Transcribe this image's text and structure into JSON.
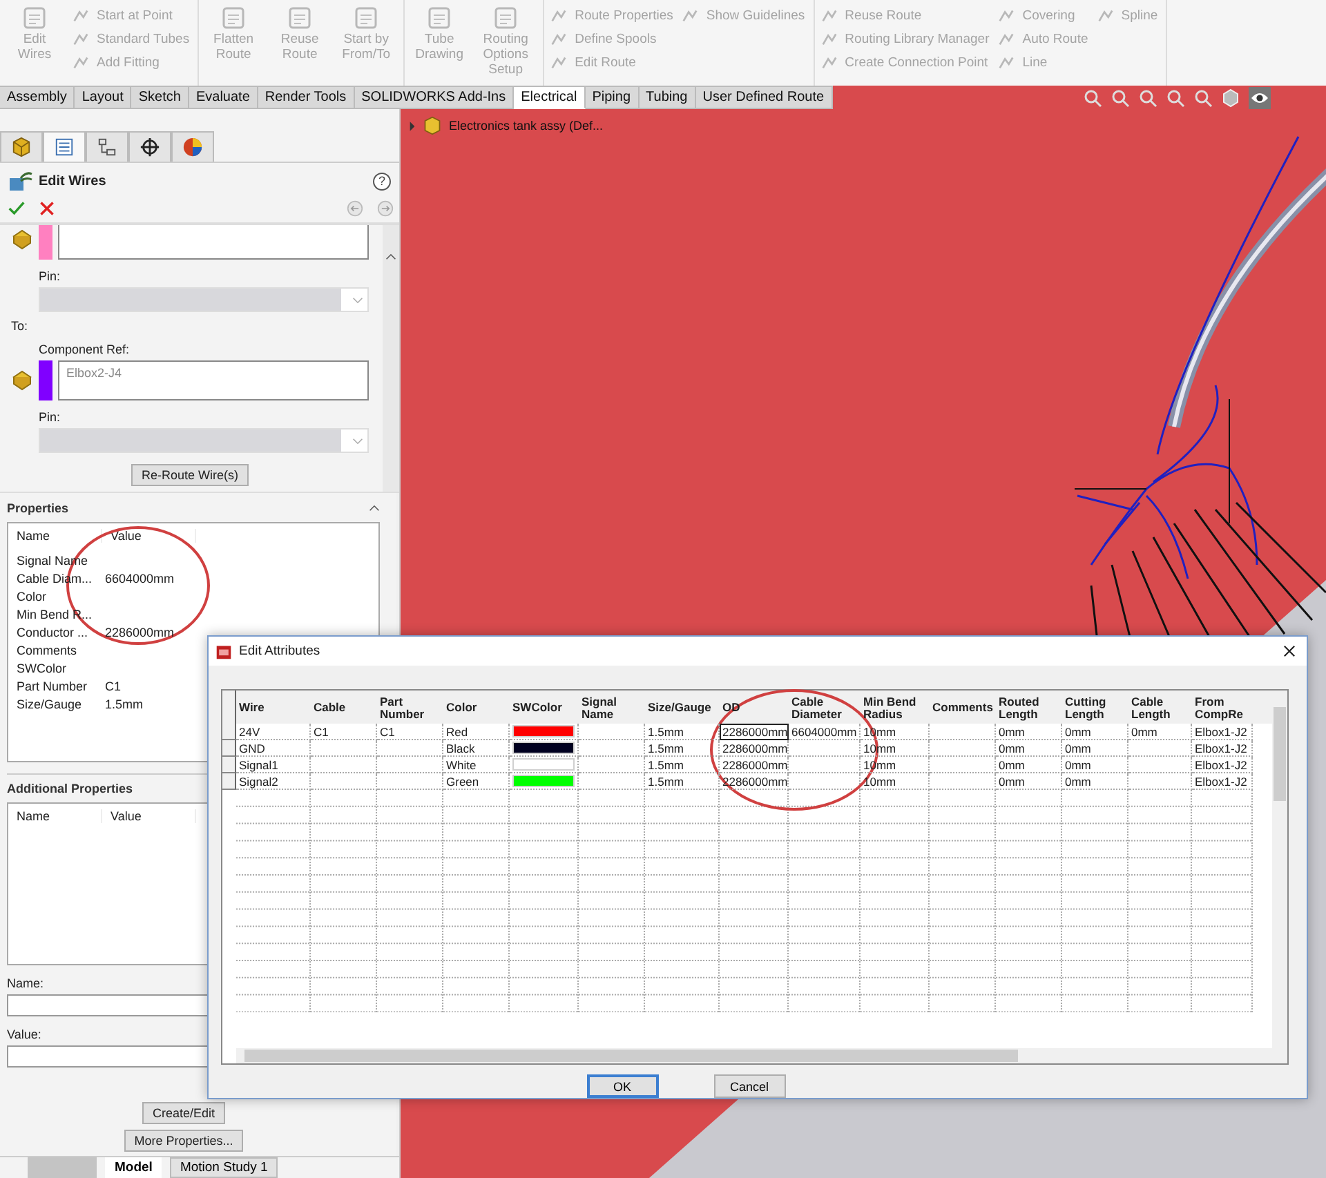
{
  "toolbar": [
    {
      "items": [
        {
          "kind": "large",
          "label": "Edit Wires",
          "disabled": true
        },
        {
          "kind": "stack",
          "items": [
            {
              "label": "Start at Point",
              "disabled": true
            },
            {
              "label": "Standard Tubes",
              "disabled": true
            },
            {
              "label": "Add Fitting",
              "disabled": true
            }
          ]
        }
      ]
    },
    {
      "items": [
        {
          "kind": "large",
          "label": "Flatten Route",
          "disabled": true
        },
        {
          "kind": "large",
          "label": "Reuse Route",
          "disabled": true
        },
        {
          "kind": "large",
          "label": "Start by From/To",
          "disabled": true
        }
      ]
    },
    {
      "items": [
        {
          "kind": "large",
          "label": "Tube Drawing",
          "disabled": true
        },
        {
          "kind": "large",
          "label": "Routing Options Setup",
          "disabled": true
        }
      ]
    },
    {
      "items": [
        {
          "kind": "stack",
          "items": [
            {
              "label": "Route Properties",
              "disabled": true
            },
            {
              "label": "Define Spools",
              "disabled": true
            },
            {
              "label": "Edit Route",
              "disabled": true
            }
          ]
        },
        {
          "kind": "stack",
          "items": [
            {
              "label": "Show Guidelines",
              "disabled": true
            }
          ]
        }
      ]
    },
    {
      "items": [
        {
          "kind": "stack",
          "items": [
            {
              "label": "Reuse Route",
              "disabled": true
            },
            {
              "label": "Routing Library Manager",
              "disabled": true
            },
            {
              "label": "Create Connection Point",
              "disabled": true
            }
          ]
        },
        {
          "kind": "stack",
          "items": [
            {
              "label": "Covering",
              "disabled": true
            },
            {
              "label": "Auto Route",
              "disabled": true
            },
            {
              "label": "Line",
              "disabled": true
            }
          ]
        },
        {
          "kind": "stack",
          "items": [
            {
              "label": "Spline",
              "disabled": true
            }
          ]
        }
      ]
    }
  ],
  "command_tabs": [
    {
      "label": "Assembly",
      "selected": false
    },
    {
      "label": "Layout",
      "selected": false
    },
    {
      "label": "Sketch",
      "selected": false
    },
    {
      "label": "Evaluate",
      "selected": false
    },
    {
      "label": "Render Tools",
      "selected": false
    },
    {
      "label": "SOLIDWORKS Add-Ins",
      "selected": false
    },
    {
      "label": "Electrical",
      "selected": true
    },
    {
      "label": "Piping",
      "selected": false
    },
    {
      "label": "Tubing",
      "selected": false
    },
    {
      "label": "User Defined Route",
      "selected": false
    }
  ],
  "feature_tree": {
    "item": "Electronics tank assy  (Def..."
  },
  "panel_tabs": [
    {
      "kind": "feature",
      "selected": false
    },
    {
      "kind": "property",
      "selected": true
    },
    {
      "kind": "configuration",
      "selected": false
    },
    {
      "kind": "target",
      "selected": false
    },
    {
      "kind": "appearance",
      "selected": false
    }
  ],
  "property_manager": {
    "title": "Edit Wires",
    "help_button": "?",
    "from": {
      "color": "#ff80c0",
      "pin_label": "Pin:",
      "pin_disabled": true
    },
    "to": {
      "label": "To:",
      "ref_label": "Component Ref:",
      "ref_value": "Elbox2-J4",
      "color": "#8000ff",
      "pin_label": "Pin:",
      "pin_disabled": true
    },
    "reroute_button": "Re-Route Wire(s)",
    "properties": {
      "title": "Properties",
      "columns": [
        "Name",
        "Value"
      ],
      "rows": [
        {
          "name": "Signal Name"
        },
        {
          "name": "Cable Diam...",
          "value": "6604000mm"
        },
        {
          "name": "Color"
        },
        {
          "name": "Min Bend R..."
        },
        {
          "name": "Conductor ...",
          "value": "2286000mm"
        },
        {
          "name": "Comments"
        },
        {
          "name": "SWColor"
        },
        {
          "name": "Part Number",
          "value": "C1"
        },
        {
          "name": "Size/Gauge",
          "value": "1.5mm"
        }
      ]
    },
    "additional_properties": {
      "title": "Additional Properties",
      "columns": [
        "Name",
        "Value"
      ]
    },
    "name_label": "Name:",
    "value_label": "Value:",
    "create_button": "Create/Edit",
    "more_button": "More Properties..."
  },
  "bottom_tabs": [
    {
      "label": "Model",
      "selected": true
    },
    {
      "label": "Motion Study 1",
      "selected": false
    }
  ],
  "dialog": {
    "title": "Edit Attributes",
    "columns": [
      "Wire",
      "Cable",
      "Part Number",
      "Color",
      "SWColor",
      "Signal Name",
      "Size/Gauge",
      "OD",
      "Cable Diameter",
      "Min Bend Radius",
      "Comments",
      "Routed Length",
      "Cutting Length",
      "Cable Length",
      "From CompRe"
    ],
    "rows": [
      {
        "cells": [
          "24V",
          "C1",
          "C1",
          "Red",
          {
            "color": "#ff0000"
          },
          null,
          "1.5mm",
          {
            "text": "2286000mm",
            "focused": true
          },
          "6604000mm",
          "10mm",
          null,
          "0mm",
          "0mm",
          "0mm",
          "Elbox1-J2"
        ]
      },
      {
        "cells": [
          "GND",
          null,
          null,
          "Black",
          {
            "color": "#000020"
          },
          null,
          "1.5mm",
          {
            "text": "2286000mm",
            "focused": false
          },
          null,
          "10mm",
          null,
          "0mm",
          "0mm",
          null,
          "Elbox1-J2"
        ]
      },
      {
        "cells": [
          "Signal1",
          null,
          null,
          "White",
          {
            "color": "#ffffff"
          },
          null,
          "1.5mm",
          {
            "text": "2286000mm",
            "focused": false
          },
          null,
          "10mm",
          null,
          "0mm",
          "0mm",
          null,
          "Elbox1-J2"
        ]
      },
      {
        "cells": [
          "Signal2",
          null,
          null,
          "Green",
          {
            "color": "#00ff00"
          },
          null,
          "1.5mm",
          {
            "text": "2286000mm",
            "focused": false
          },
          null,
          "10mm",
          null,
          "0mm",
          "0mm",
          null,
          "Elbox1-J2"
        ]
      }
    ],
    "ok_button": "OK",
    "cancel_button": "Cancel"
  }
}
